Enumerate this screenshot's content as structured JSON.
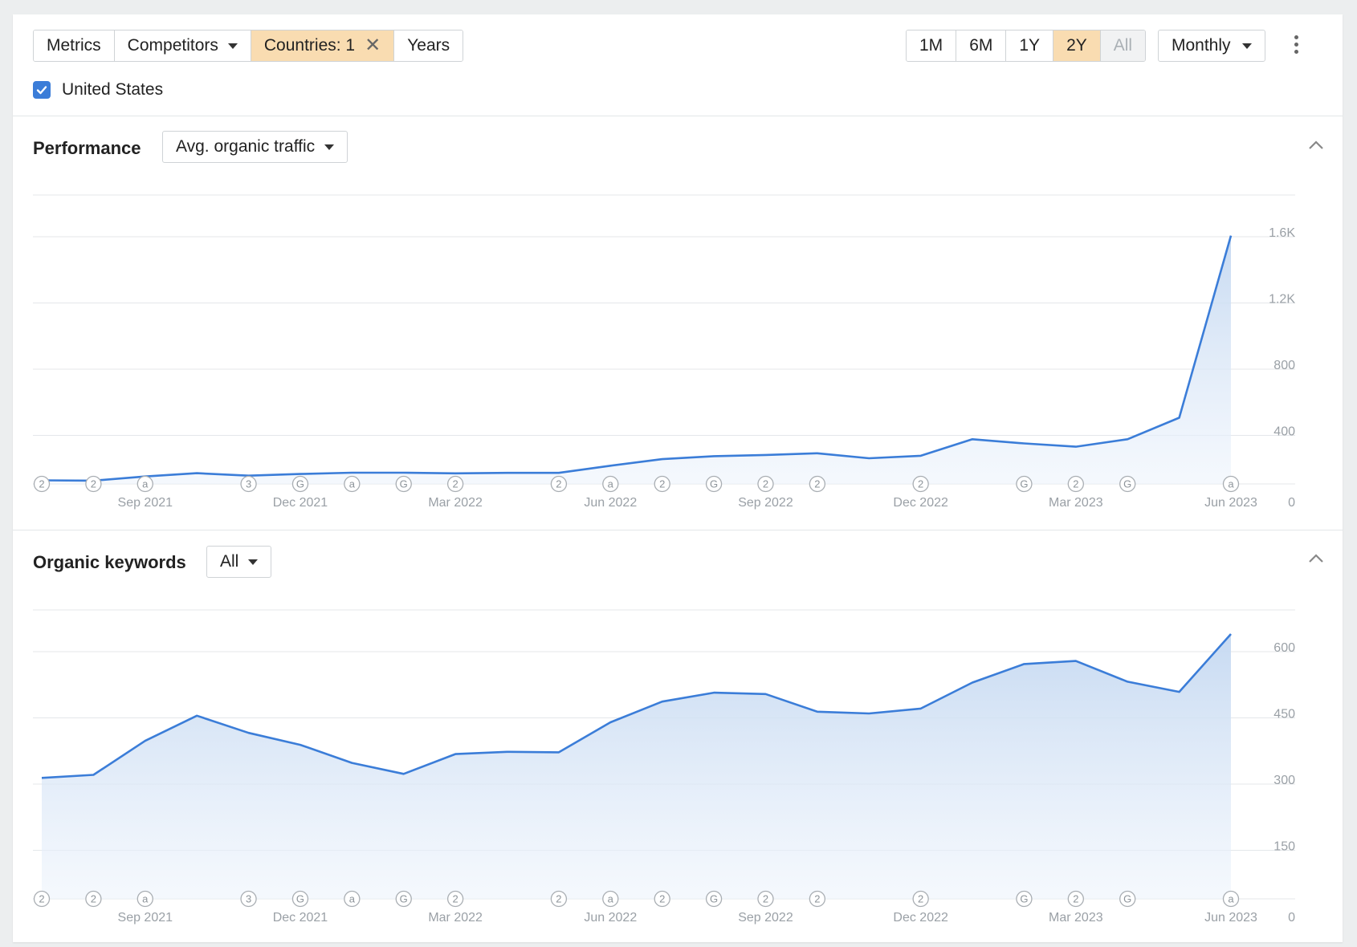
{
  "toolbar": {
    "metrics": "Metrics",
    "competitors": "Competitors",
    "countries": "Countries: 1",
    "years": "Years"
  },
  "range": [
    "1M",
    "6M",
    "1Y",
    "2Y",
    "All"
  ],
  "range_active": "2Y",
  "range_disabled": "All",
  "interval": "Monthly",
  "country": {
    "label": "United States",
    "checked": true
  },
  "performance": {
    "title": "Performance",
    "metric": "Avg. organic traffic"
  },
  "keywords": {
    "title": "Organic keywords",
    "filter": "All"
  },
  "colors": {
    "line": "#3b7dd8",
    "active_tab": "#f9dcb1",
    "checkbox": "#3b7dd8"
  },
  "chart_data": [
    {
      "type": "area",
      "name": "performance",
      "x": [
        "Jul 2021",
        "Aug 2021",
        "Sep 2021",
        "Oct 2021",
        "Nov 2021",
        "Dec 2021",
        "Jan 2022",
        "Feb 2022",
        "Mar 2022",
        "Apr 2022",
        "May 2022",
        "Jun 2022",
        "Jul 2022",
        "Aug 2022",
        "Sep 2022",
        "Oct 2022",
        "Nov 2022",
        "Dec 2022",
        "Jan 2023",
        "Feb 2023",
        "Mar 2023",
        "Apr 2023",
        "May 2023",
        "Jun 2023"
      ],
      "values": [
        22,
        20,
        45,
        65,
        50,
        60,
        68,
        68,
        64,
        67,
        67,
        110,
        150,
        168,
        175,
        185,
        155,
        170,
        270,
        245,
        225,
        270,
        400,
        1500
      ],
      "y_ticks": [
        "0",
        "400",
        "800",
        "1.2K",
        "1.6K"
      ],
      "ylim": [
        0,
        1600
      ],
      "x_tick_labels": [
        "Sep 2021",
        "Dec 2021",
        "Mar 2022",
        "Jun 2022",
        "Sep 2022",
        "Dec 2022",
        "Mar 2023",
        "Jun 2023"
      ],
      "grid": true
    },
    {
      "type": "area",
      "name": "organic-keywords",
      "x": [
        "Jul 2021",
        "Aug 2021",
        "Sep 2021",
        "Oct 2021",
        "Nov 2021",
        "Dec 2021",
        "Jan 2022",
        "Feb 2022",
        "Mar 2022",
        "Apr 2022",
        "May 2022",
        "Jun 2022",
        "Jul 2022",
        "Aug 2022",
        "Sep 2022",
        "Oct 2022",
        "Nov 2022",
        "Dec 2022",
        "Jan 2023",
        "Feb 2023",
        "Mar 2023",
        "Apr 2023",
        "May 2023",
        "Jun 2023"
      ],
      "values": [
        274,
        281,
        358,
        415,
        376,
        349,
        308,
        283,
        328,
        333,
        332,
        400,
        447,
        467,
        464,
        424,
        420,
        431,
        490,
        532,
        539,
        492,
        469,
        600
      ],
      "y_ticks": [
        "0",
        "150",
        "300",
        "450",
        "600"
      ],
      "ylim": [
        0,
        600
      ],
      "x_tick_labels": [
        "Sep 2021",
        "Dec 2021",
        "Mar 2022",
        "Jun 2022",
        "Sep 2022",
        "Dec 2022",
        "Mar 2023",
        "Jun 2023"
      ],
      "grid": true
    }
  ],
  "annotations": [
    "2",
    "2",
    "a",
    "",
    "3",
    "G",
    "a",
    "G",
    "2",
    "",
    "2",
    "a",
    "2",
    "G",
    "2",
    "2",
    "",
    "2",
    "",
    "G",
    "2",
    "G",
    "",
    "a"
  ]
}
